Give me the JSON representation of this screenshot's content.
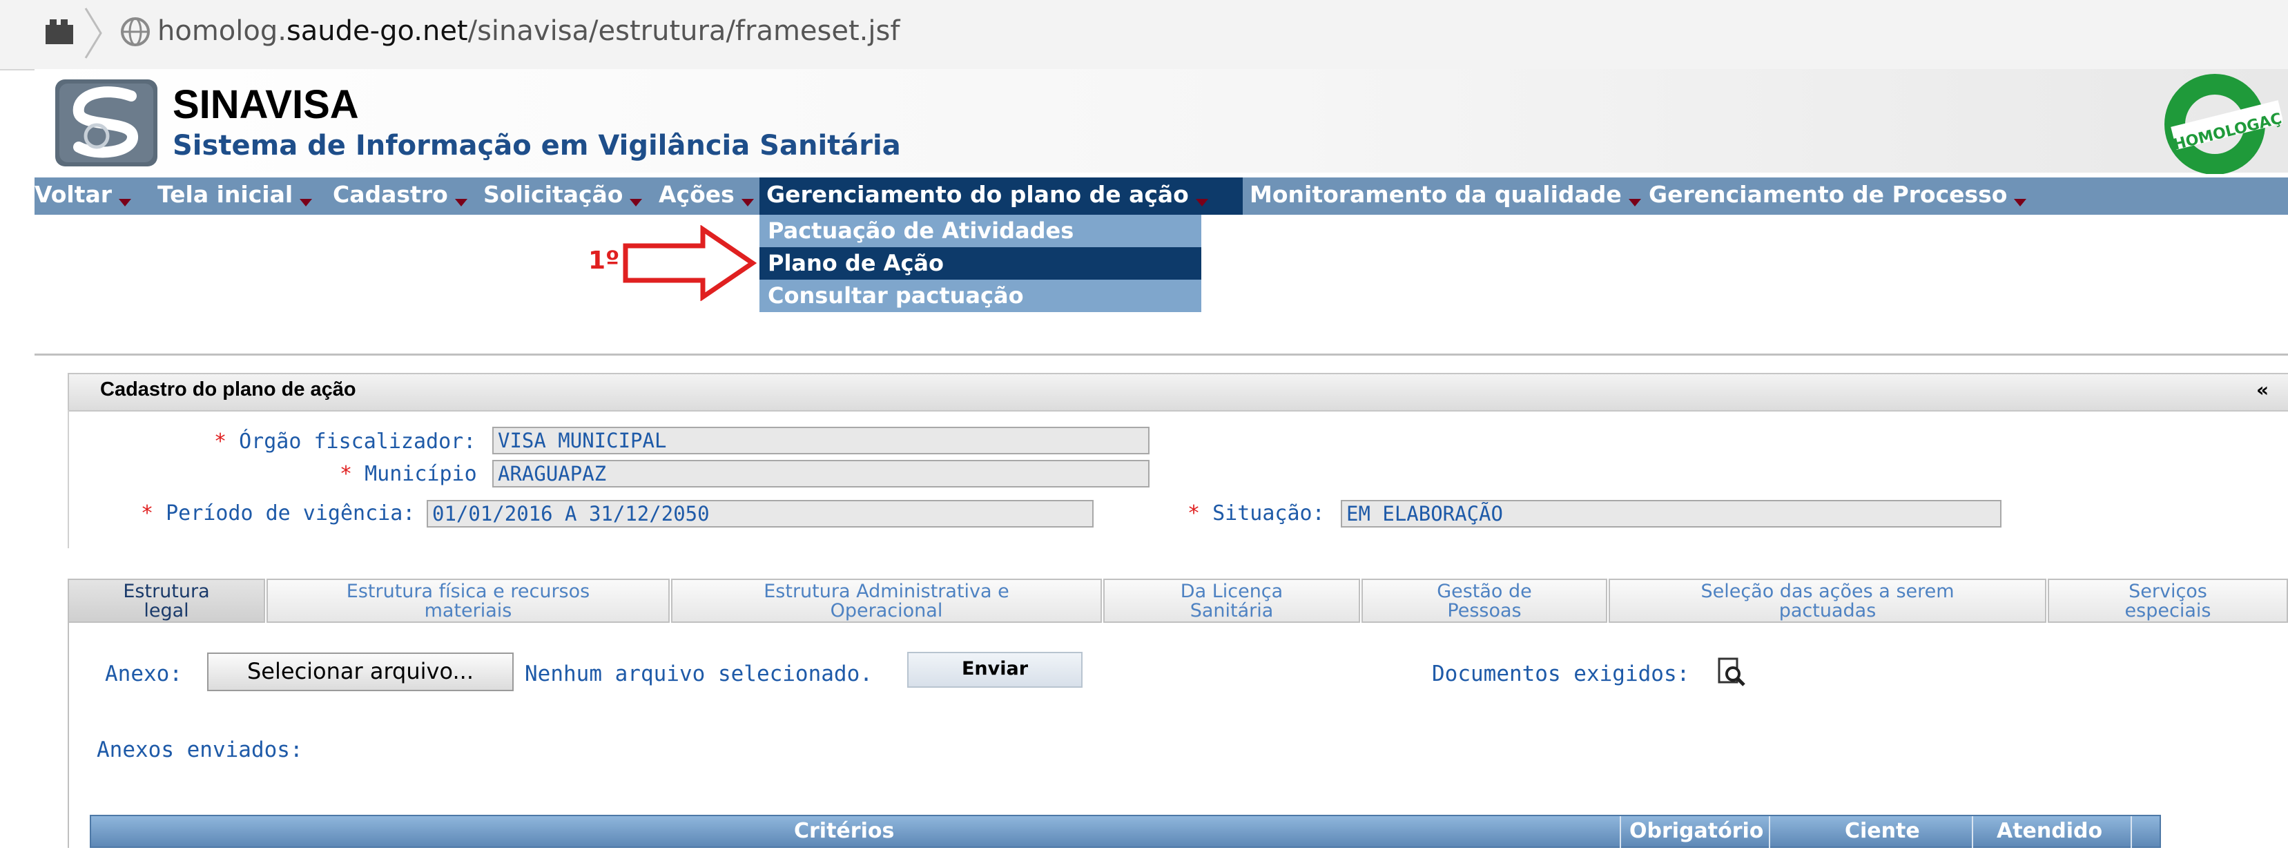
{
  "browser": {
    "url_host": "homolog.",
    "url_domain": "saude-go.net",
    "url_path": "/sinavisa/estrutura/frameset.jsf"
  },
  "app": {
    "title": "SINAVISA",
    "subtitle": "Sistema de Informação em Vigilância Sanitária",
    "badge": "HOMOLOGAÇÃO"
  },
  "menu": {
    "items": [
      "Voltar",
      "Tela inicial",
      "Cadastro",
      "Solicitação",
      "Ações",
      "Gerenciamento do plano de ação",
      "Monitoramento da qualidade",
      "Gerenciamento de Processo"
    ],
    "active_index": 5
  },
  "dropdown": {
    "items": [
      "Pactuação de Atividades",
      "Plano de Ação",
      "Consultar pactuação"
    ],
    "active_index": 1
  },
  "annotation": {
    "label": "1º"
  },
  "panel": {
    "title": "Cadastro do plano de ação",
    "collapse": "«",
    "fields": {
      "orgao_label": "Órgão fiscalizador:",
      "orgao_value": "VISA MUNICIPAL",
      "municipio_label": "Município",
      "municipio_value": "ARAGUAPAZ",
      "periodo_label": "Período de vigência:",
      "periodo_value": "01/01/2016 A 31/12/2050",
      "situacao_label": "Situação:",
      "situacao_value": "EM ELABORAÇÃO"
    }
  },
  "tabs": [
    {
      "line1": "Estrutura",
      "line2": "legal"
    },
    {
      "line1": "Estrutura física e recursos",
      "line2": "materiais"
    },
    {
      "line1": "Estrutura Administrativa e",
      "line2": "Operacional"
    },
    {
      "line1": "Da Licença",
      "line2": "Sanitária"
    },
    {
      "line1": "Gestão de",
      "line2": "Pessoas"
    },
    {
      "line1": "Seleção das ações a serem",
      "line2": "pactuadas"
    },
    {
      "line1": "Serviços",
      "line2": "especiais"
    }
  ],
  "attachment": {
    "label": "Anexo:",
    "choose_button": "Selecionar arquivo...",
    "no_file": "Nenhum arquivo selecionado.",
    "send_button": "Enviar",
    "docs_label": "Documentos exigidos:",
    "sent_label": "Anexos enviados:"
  },
  "table": {
    "headers": [
      "Critérios",
      "Obrigatório",
      "Ciente",
      "Atendido"
    ]
  },
  "colors": {
    "menubar": "#6f93b7",
    "active": "#0d3a6a",
    "dropdown": "#7fa6cc",
    "accent_red": "#e02020",
    "label_blue": "#1e5aa8",
    "badge_green": "#1f9a3a"
  }
}
